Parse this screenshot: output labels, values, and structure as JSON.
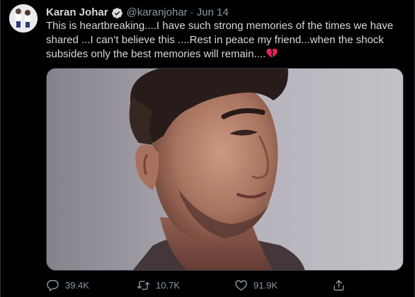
{
  "tweet": {
    "author_name": "Karan Johar",
    "handle": "@karanjohar",
    "separator": "·",
    "date": "Jun 14",
    "verified": true,
    "text": "This is heartbreaking....I have such strong memories of the times we have shared ...I can’t believe this ....Rest in peace my friend...when the shock subsides only the best memories will remain....",
    "emoji_icon": "broken-heart-icon",
    "media_type": "photo"
  },
  "actions": {
    "reply_count": "39.4K",
    "retweet_count": "10.7K",
    "like_count": "91.9K",
    "share_icon": "share-icon"
  },
  "colors": {
    "background": "#000000",
    "text": "#d9d9d9",
    "secondary": "#8b98a5",
    "verified": "#1da1f2",
    "broken_heart": "#e0245e"
  }
}
